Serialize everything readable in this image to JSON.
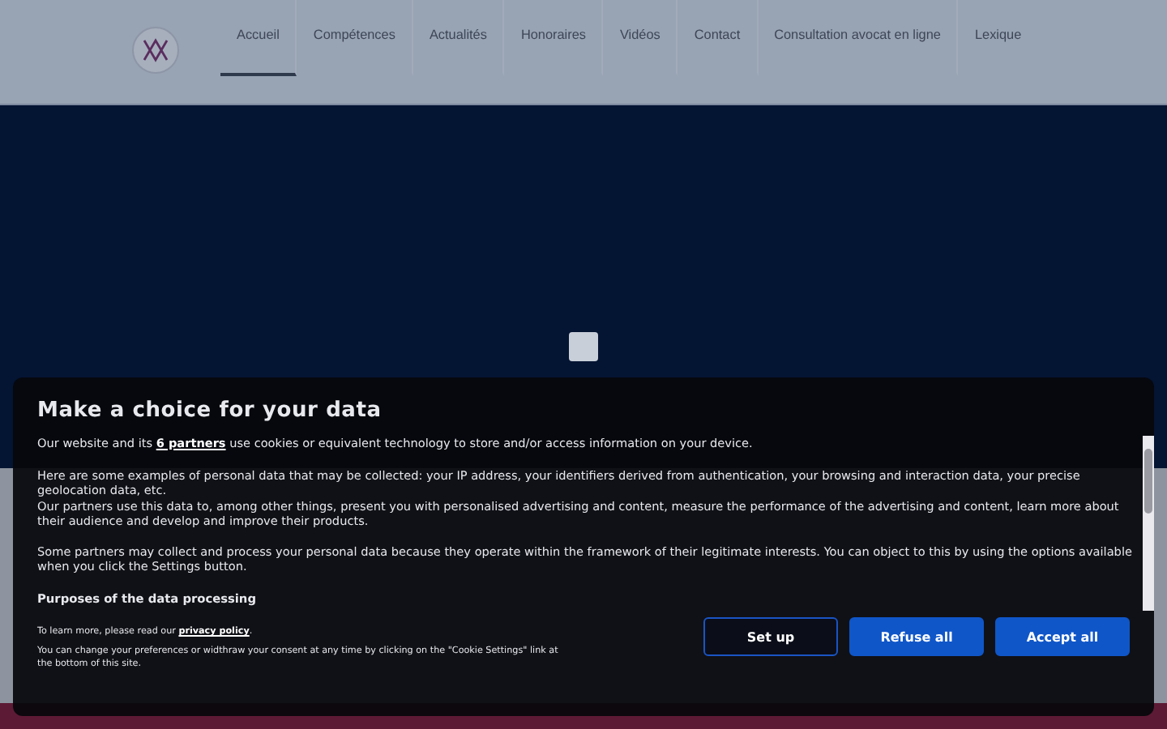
{
  "nav": {
    "items": [
      {
        "label": "Accueil",
        "selected": true
      },
      {
        "label": "Compétences",
        "selected": false
      },
      {
        "label": "Actualités",
        "selected": false
      },
      {
        "label": "Honoraires",
        "selected": false
      },
      {
        "label": "Vidéos",
        "selected": false
      },
      {
        "label": "Contact",
        "selected": false
      },
      {
        "label": "Consultation avocat en ligne",
        "selected": false
      },
      {
        "label": "Lexique",
        "selected": false
      }
    ]
  },
  "consent": {
    "title": "Make a choice for your data",
    "intro": {
      "before": "Our website and its ",
      "link": "6 partners",
      "after": " use cookies or equivalent technology to store and/or access information on your device."
    },
    "paragraphs": [
      "Here are some examples of personal data that may be collected: your IP address, your identifiers derived from authentication, your browsing and interaction data, your precise geolocation data, etc.",
      "Our partners use this data to, among other things, present you with personalised advertising and content, measure the performance of the advertising and content, learn more about their audience and develop and improve their products.",
      "Some partners may collect and process your personal data because they operate within the framework of their legitimate interests. You can object to this by using the options available when you click the Settings button."
    ],
    "section_title": "Purposes of the data processing",
    "privacy_note": {
      "before": "To learn more, please read our ",
      "link": "privacy policy",
      "after": "."
    },
    "notes": [
      "You can change your preferences or widthraw your consent at any time by clicking on the \"Cookie Settings\" link at the bottom of this site."
    ],
    "buttons": [
      {
        "label": "Set up",
        "kind": "outline"
      },
      {
        "label": "Refuse all",
        "kind": "solid"
      },
      {
        "label": "Accept all",
        "kind": "solid"
      }
    ]
  }
}
